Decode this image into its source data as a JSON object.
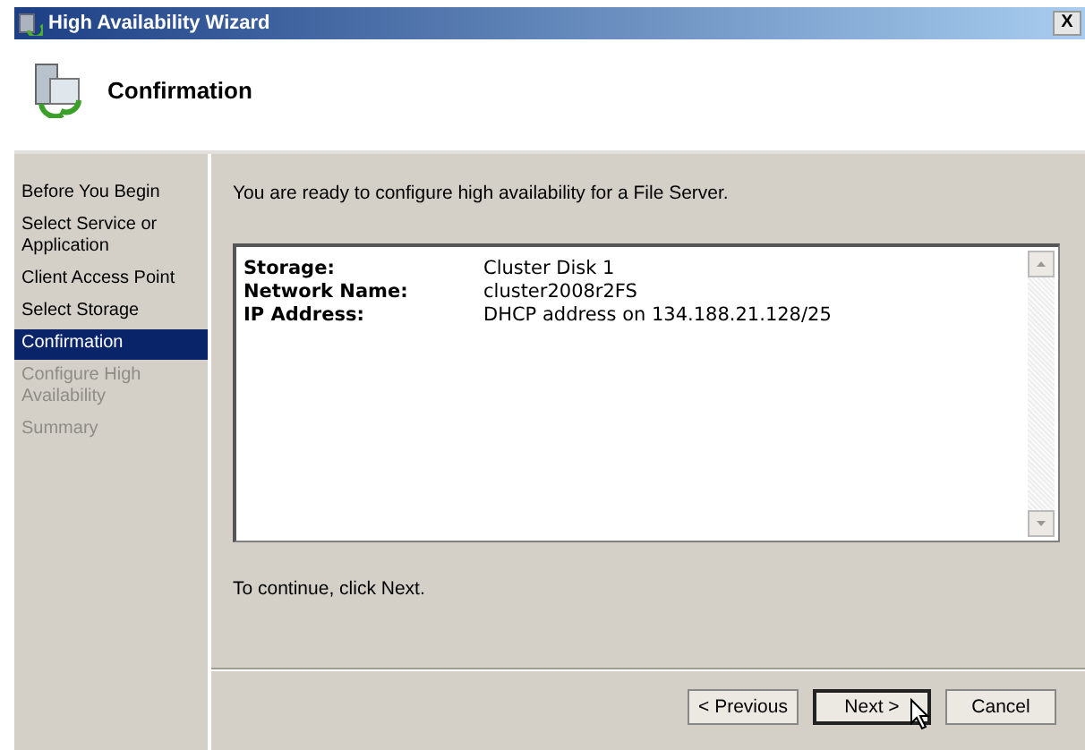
{
  "window": {
    "title": "High Availability Wizard",
    "close": "X"
  },
  "header": {
    "title": "Confirmation"
  },
  "sidebar": {
    "items": [
      {
        "label": "Before You Begin",
        "selected": false,
        "disabled": false
      },
      {
        "label": "Select Service or Application",
        "selected": false,
        "disabled": false
      },
      {
        "label": "Client Access Point",
        "selected": false,
        "disabled": false
      },
      {
        "label": "Select Storage",
        "selected": false,
        "disabled": false
      },
      {
        "label": "Confirmation",
        "selected": true,
        "disabled": false
      },
      {
        "label": "Configure High Availability",
        "selected": false,
        "disabled": true
      },
      {
        "label": "Summary",
        "selected": false,
        "disabled": true
      }
    ]
  },
  "intro": "You are ready to configure high availability for a File Server.",
  "details": [
    {
      "label": "Storage:",
      "value": "Cluster Disk 1"
    },
    {
      "label": "Network Name:",
      "value": "cluster2008r2FS"
    },
    {
      "label": "IP Address:",
      "value": "DHCP address on 134.188.21.128/25"
    }
  ],
  "footer_note": "To continue, click Next.",
  "buttons": [
    {
      "label": "< Previous",
      "selected": false
    },
    {
      "label": "Next >",
      "selected": true
    },
    {
      "label": "Cancel",
      "selected": false
    }
  ]
}
